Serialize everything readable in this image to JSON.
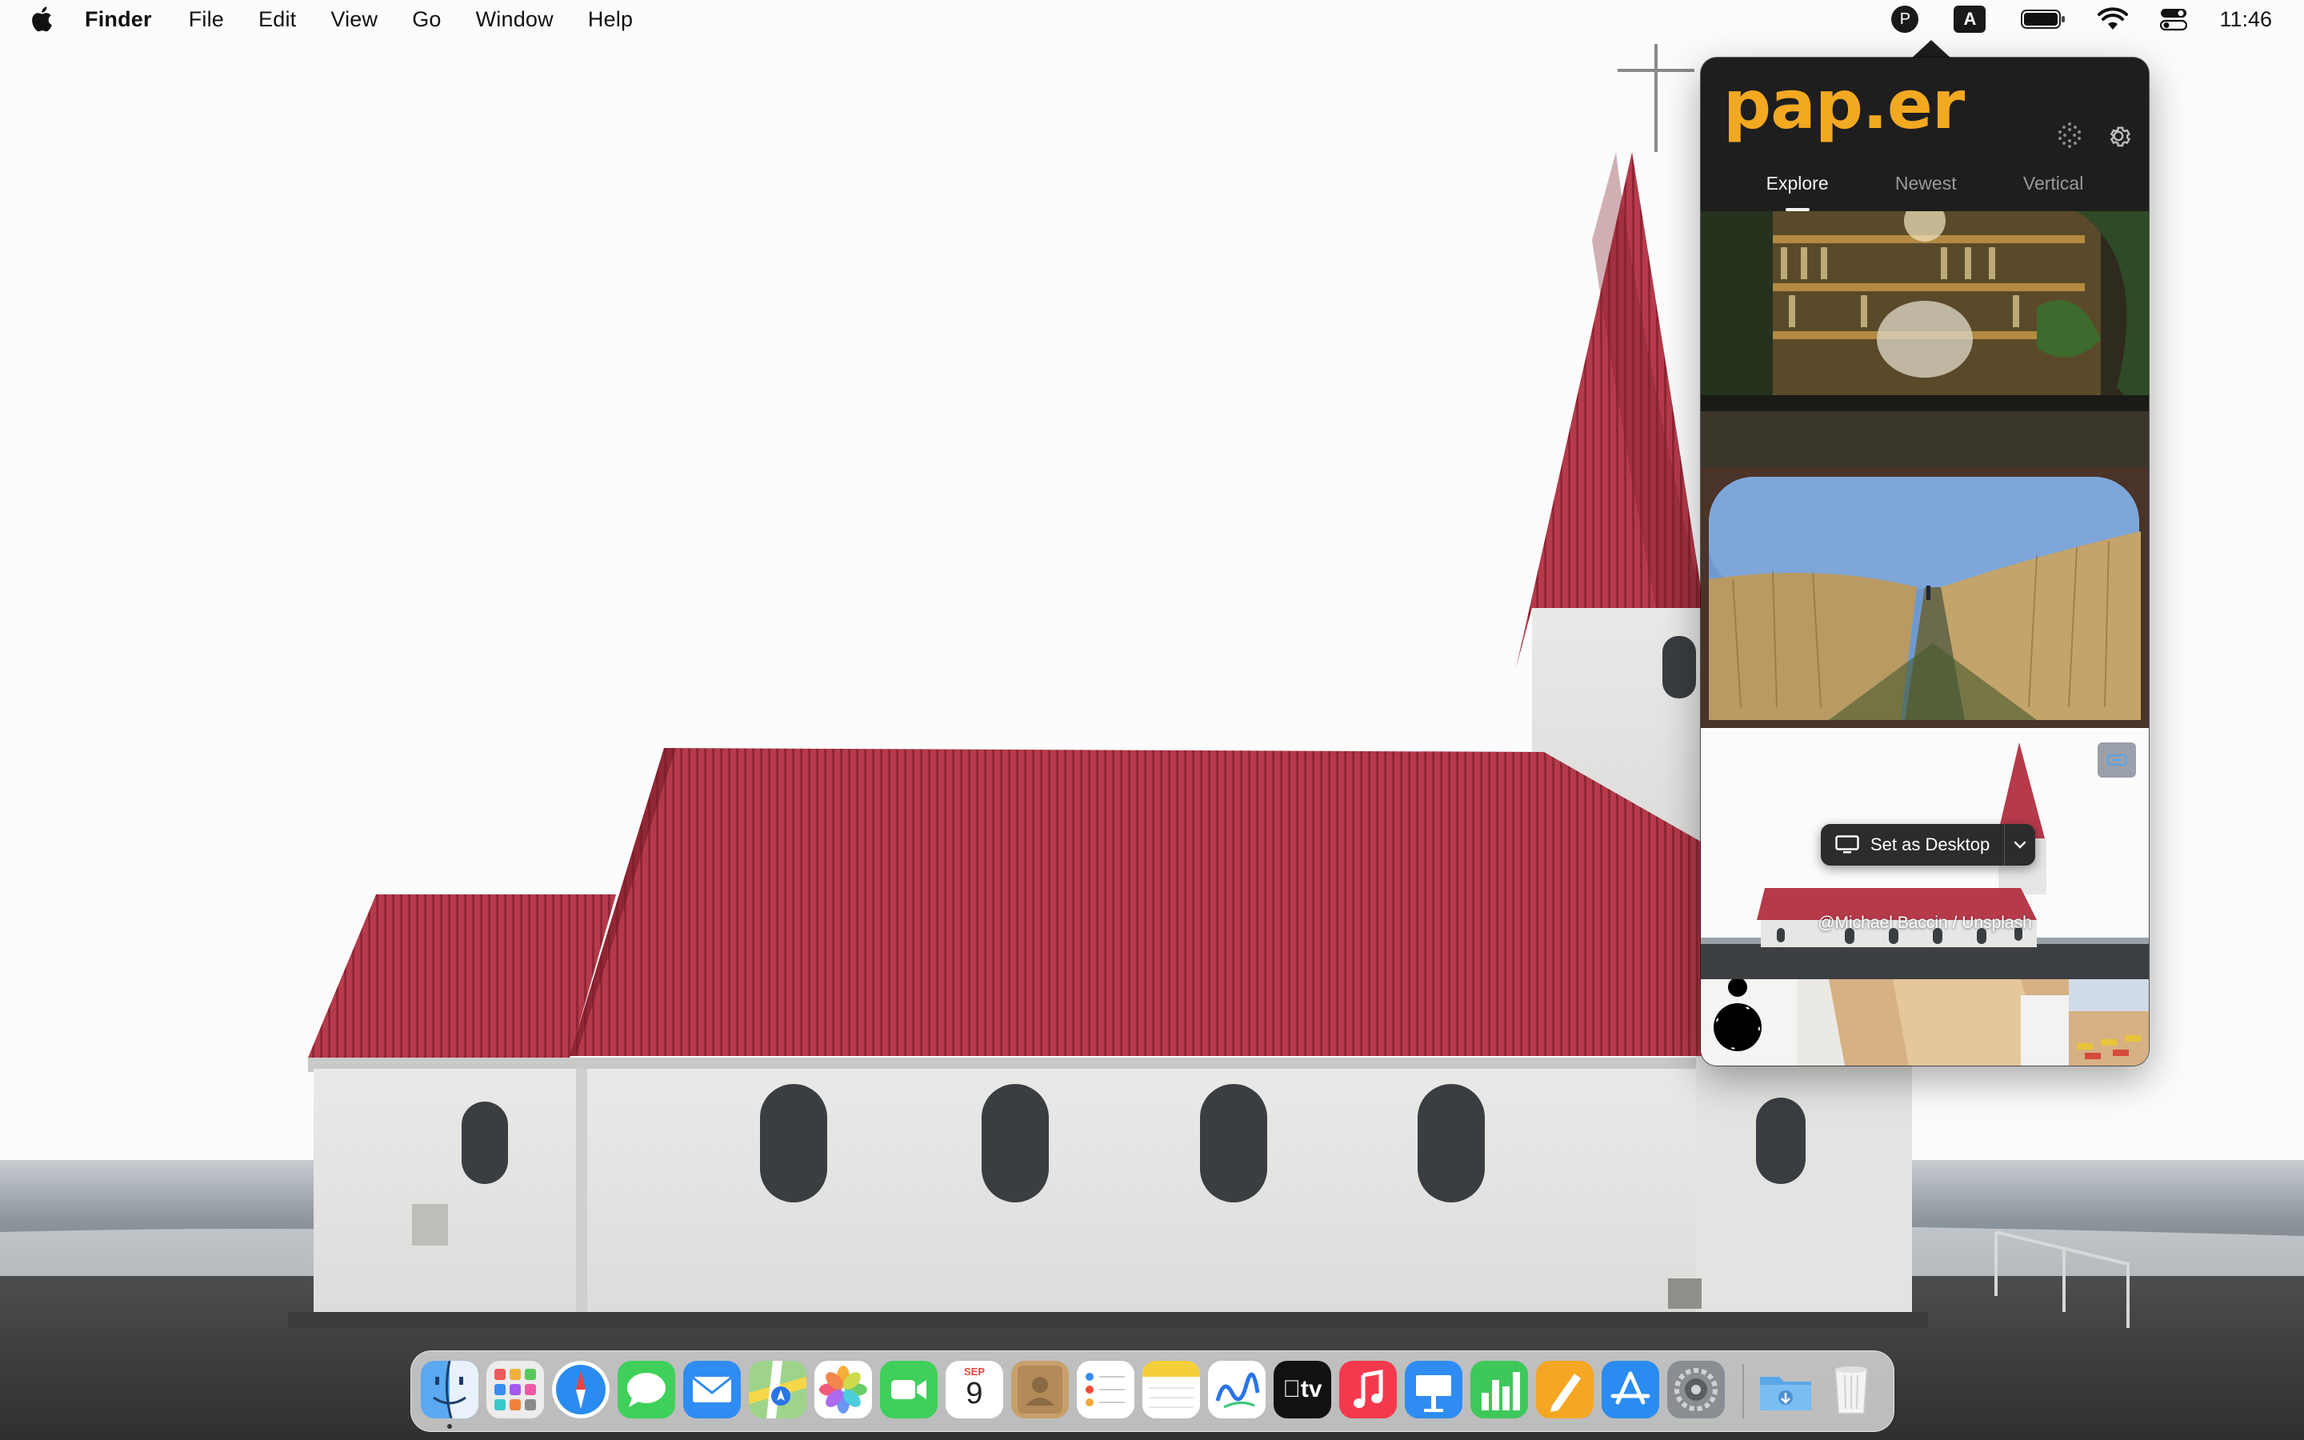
{
  "menubar": {
    "app_name": "Finder",
    "items": [
      "File",
      "Edit",
      "View",
      "Go",
      "Window",
      "Help"
    ],
    "status": {
      "paper_letter": "P",
      "input_source": "A",
      "clock": "11:46"
    }
  },
  "popover": {
    "brand": "pap.er",
    "tabs": [
      {
        "label": "Explore",
        "active": true
      },
      {
        "label": "Newest",
        "active": false
      },
      {
        "label": "Vertical",
        "active": false
      }
    ],
    "hover_thumbnail": {
      "set_desktop_label": "Set as Desktop",
      "credit": "@Michael Baccin / Unsplash"
    },
    "icons": [
      "grid-icon",
      "settings-gear-icon"
    ]
  },
  "dock": {
    "apps": [
      "Finder",
      "Launchpad",
      "Safari",
      "Messages",
      "Mail",
      "Maps",
      "Photos",
      "FaceTime",
      "Calendar",
      "Contacts",
      "Reminders",
      "Notes",
      "Freeform",
      "TV",
      "Music",
      "Keynote",
      "Numbers",
      "Pages",
      "App Store",
      "System Settings"
    ],
    "calendar": {
      "month": "SEP",
      "day": "9"
    },
    "tv_label": "tv",
    "extras": [
      "Downloads",
      "Trash"
    ]
  }
}
